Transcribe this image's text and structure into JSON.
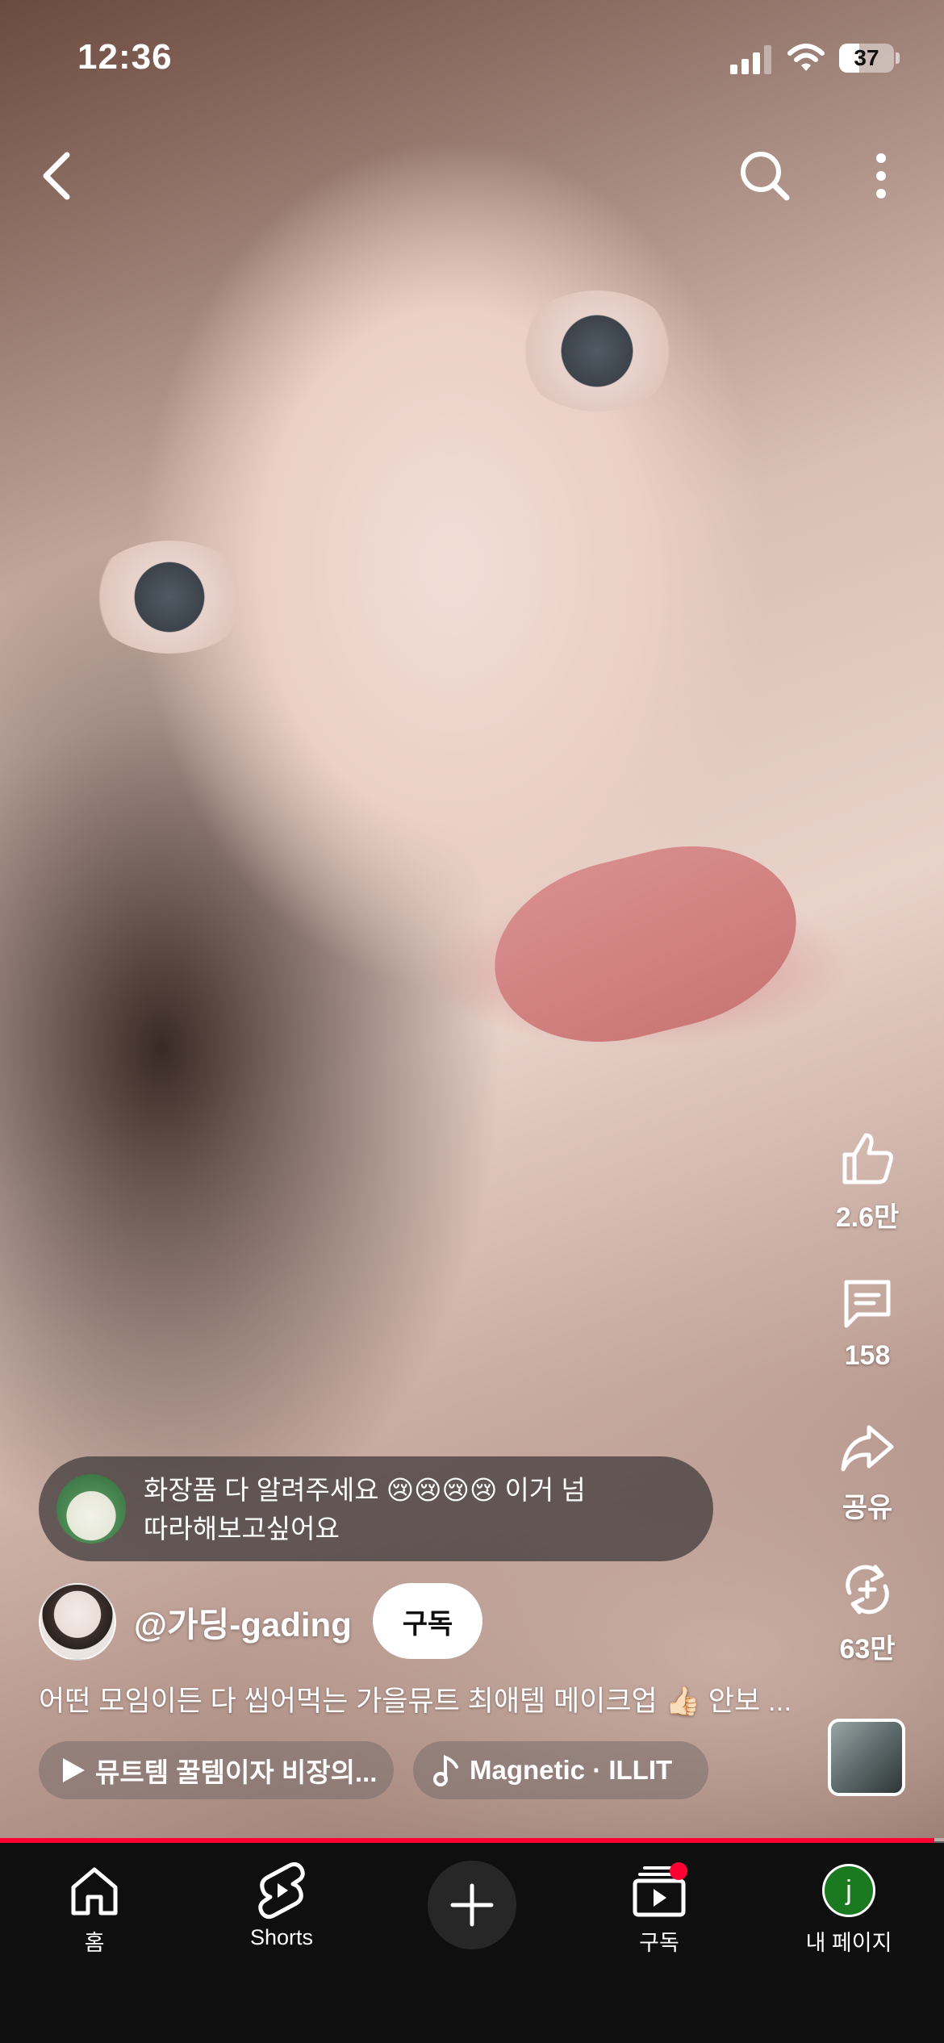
{
  "status_bar": {
    "time": "12:36",
    "battery": "37",
    "battery_level": 0.37,
    "signal_bars_active": 3,
    "icons": [
      "cellular-signal-icon",
      "wifi-icon",
      "battery-icon"
    ]
  },
  "top_nav": {
    "icons": [
      "back-arrow-icon",
      "search-icon",
      "more-vertical-icon"
    ]
  },
  "actions": {
    "like": {
      "label": "2.6만",
      "icon": "thumbs-up-icon"
    },
    "comments": {
      "label": "158",
      "icon": "comment-icon"
    },
    "share": {
      "label": "공유",
      "icon": "share-arrow-icon"
    },
    "remix": {
      "label": "63만",
      "icon": "remix-icon"
    }
  },
  "comment_highlight": {
    "line1": "화장품 다 알려주세요 😢😢😢😢 이거 넘",
    "line2": "따라해보고싶어요"
  },
  "channel": {
    "name": "@가딩-gading",
    "subscribe_label": "구독"
  },
  "video": {
    "description": "어떤 모임이든 다 씹어먹는 가을뮤트 최애템 메이크업 👍🏻 안보 ...",
    "progress": 0.99
  },
  "chips": {
    "related": {
      "label": "뮤트템 꿀템이자 비장의...",
      "icon": "play-icon"
    },
    "music": {
      "label": "Magnetic · ILLIT",
      "icon": "music-note-icon"
    }
  },
  "bottom_nav": {
    "home": {
      "label": "홈",
      "icon": "home-icon"
    },
    "shorts": {
      "label": "Shorts",
      "icon": "shorts-icon"
    },
    "create": {
      "icon": "plus-icon"
    },
    "subscriptions": {
      "label": "구독",
      "icon": "subscriptions-icon"
    },
    "profile": {
      "label": "내 페이지",
      "avatar_letter": "j"
    }
  },
  "colors": {
    "accent_red": "#ff0033",
    "nav_background": "#0f0f0f",
    "profile_avatar": "#1b7a1f"
  }
}
